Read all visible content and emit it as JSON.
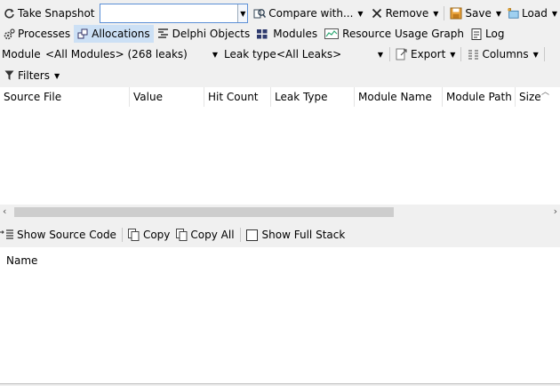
{
  "toolbar1": {
    "take_snapshot": "Take Snapshot",
    "snapshot_value": "",
    "compare": "Compare with...",
    "remove": "Remove",
    "save": "Save",
    "load": "Load"
  },
  "tabs": [
    "Processes",
    "Allocations",
    "Delphi Objects",
    "Modules",
    "Resource Usage Graph",
    "Log"
  ],
  "active_tab": "Allocations",
  "filterbar": {
    "module_label": "Module",
    "module_value": "<All Modules> (268 leaks)",
    "leaktype_label": "Leak type",
    "leaktype_value": "<All Leaks>",
    "export": "Export",
    "columns": "Columns"
  },
  "filters_label": "Filters",
  "table": {
    "columns": [
      "Source File",
      "Value",
      "Hit Count",
      "Leak Type",
      "Module Name",
      "Module Path",
      "Size"
    ]
  },
  "bottom_toolbar": {
    "show_source": "Show Source Code",
    "copy": "Copy",
    "copy_all": "Copy All",
    "show_full_stack": "Show Full Stack"
  },
  "stack_header": "Name",
  "colors": {
    "accent": "#cce0f5",
    "focus_border": "#5b8fd6",
    "scroll_thumb": "#cdcdcd"
  }
}
